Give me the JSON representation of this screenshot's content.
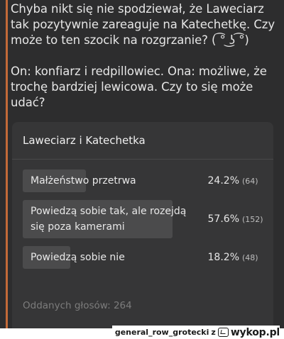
{
  "post": {
    "paragraph1": "Chyba nikt się nie spodziewał, że Laweciarz tak pozytywnie zareaguje na Katechetkę. Czy może to ten szocik na rozgrzanie? ( ͡° ͜ʖ ͡°)",
    "paragraph2": "On: konfiarz i redpillowiec. Ona: możliwe, że trochę bardziej lewicowa. Czy to się może udać?"
  },
  "poll": {
    "title": "Laweciarz i Katechetka",
    "options": [
      {
        "label": "Małżeństwo przetrwa",
        "percent": "24.2%",
        "votes": "(64)",
        "fraction": 0.242
      },
      {
        "label": "Powiedzą sobie tak, ale rozejdą się poza kamerami",
        "percent": "57.6%",
        "votes": "(152)",
        "fraction": 0.576
      },
      {
        "label": "Powiedzą sobie nie",
        "percent": "18.2%",
        "votes": "(48)",
        "fraction": 0.182
      }
    ],
    "footer": "Oddanych głosów: 264"
  },
  "watermark": {
    "username": "general_row_grotecki",
    "separator": "z",
    "site": "wykop.pl"
  },
  "colors": {
    "accent": "#c36a38",
    "background": "#2d2d2e",
    "poll_bg": "#363637",
    "bar_fill": "#4b4b4c"
  }
}
